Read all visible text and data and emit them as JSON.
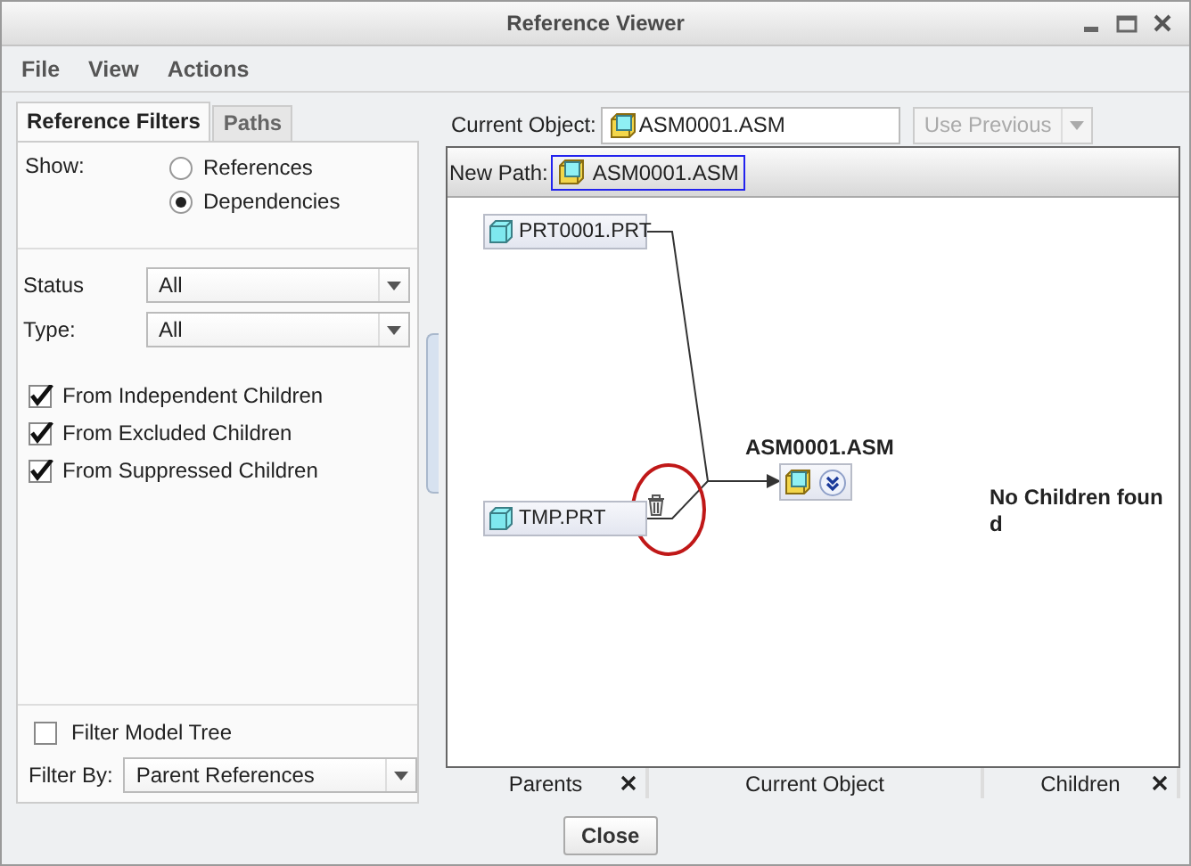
{
  "window": {
    "title": "Reference Viewer"
  },
  "menu": [
    "File",
    "View",
    "Actions"
  ],
  "tabs": [
    {
      "label": "Reference Filters",
      "selected": true
    },
    {
      "label": "Paths",
      "selected": false
    }
  ],
  "show": {
    "label": "Show:",
    "options": [
      {
        "label": "References",
        "selected": false
      },
      {
        "label": "Dependencies",
        "selected": true
      }
    ]
  },
  "filters": [
    {
      "label": "Status",
      "value": "All"
    },
    {
      "label": "Type:",
      "value": "All"
    }
  ],
  "checkboxes": [
    {
      "label": "From Independent Children",
      "checked": true
    },
    {
      "label": "From Excluded Children",
      "checked": true
    },
    {
      "label": "From Suppressed Children",
      "checked": true
    }
  ],
  "filter_model_tree": {
    "label": "Filter Model Tree",
    "checked": false
  },
  "filter_by": {
    "label": "Filter By:",
    "value": "Parent References"
  },
  "current_object": {
    "label": "Current Object:",
    "value": "ASM0001.ASM"
  },
  "use_previous": {
    "label": "Use Previous",
    "disabled": true
  },
  "new_path": {
    "label": "New Path:",
    "item": "ASM0001.ASM"
  },
  "diagram": {
    "parents": [
      {
        "name": "PRT0001.PRT",
        "marked": false
      },
      {
        "name": "TMP.PRT",
        "marked": true
      }
    ],
    "current": {
      "name": "ASM0001.ASM"
    },
    "children_message": "No Children found"
  },
  "columns": [
    {
      "label": "Parents",
      "closable": true
    },
    {
      "label": "Current Object",
      "closable": false
    },
    {
      "label": "Children",
      "closable": true
    }
  ],
  "buttons": [
    "Close"
  ]
}
